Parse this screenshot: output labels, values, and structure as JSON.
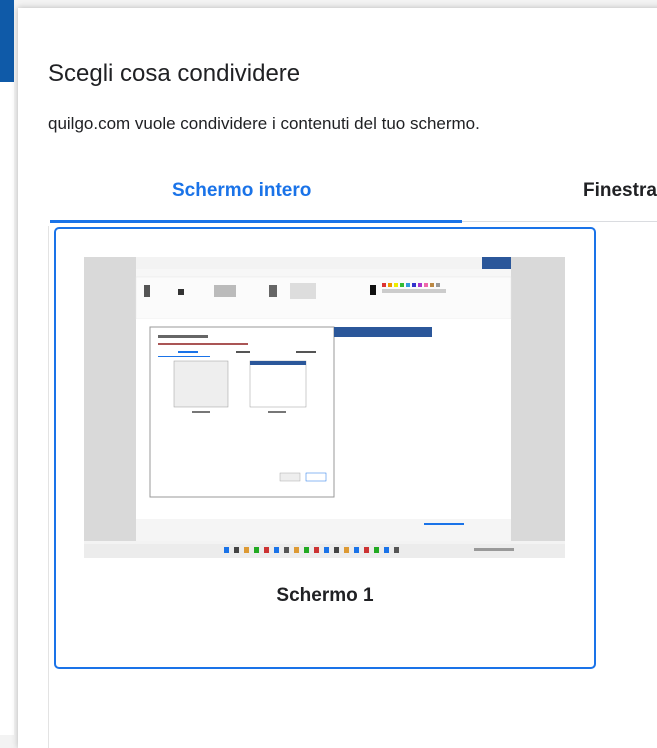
{
  "dialog": {
    "title": "Scegli cosa condividere",
    "subtitle": "quilgo.com vuole condividere i contenuti del tuo schermo."
  },
  "tabs": [
    {
      "label": "Schermo intero",
      "active": true
    },
    {
      "label": "Finestra",
      "active": false
    }
  ],
  "screens": [
    {
      "label": "Schermo 1",
      "selected": true
    }
  ],
  "colors": {
    "accent": "#1a73e8",
    "left_accent": "#0f5aa8"
  }
}
